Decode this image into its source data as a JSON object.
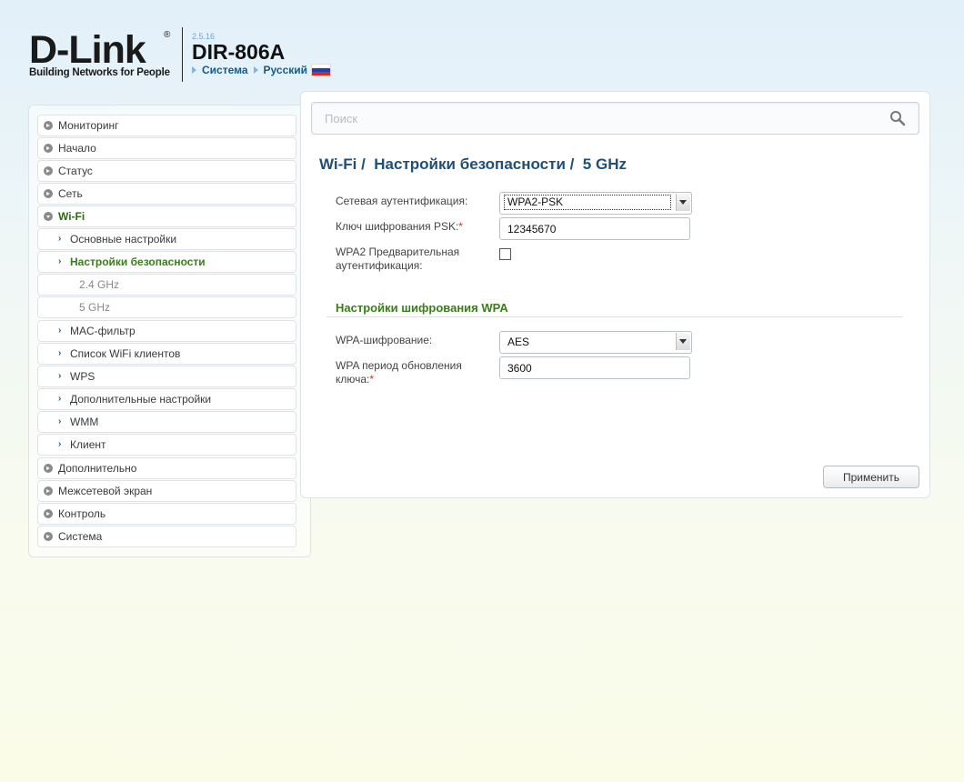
{
  "header": {
    "brand_main": "D-Link",
    "brand_reg": "®",
    "brand_tagline": "Building Networks for People",
    "firmware": "2.5.16",
    "model": "DIR-806A",
    "link_system": "Система",
    "link_language": "Русский",
    "flag_colors": [
      "#ffffff",
      "#1c3fbf",
      "#d52b1e"
    ]
  },
  "sidebar": {
    "items": [
      {
        "label": "Мониторинг"
      },
      {
        "label": "Начало"
      },
      {
        "label": "Статус"
      },
      {
        "label": "Сеть"
      },
      {
        "label": "Wi-Fi"
      },
      {
        "label": "Основные настройки"
      },
      {
        "label": "Настройки безопасности"
      },
      {
        "label": "2.4 GHz"
      },
      {
        "label": "5 GHz"
      },
      {
        "label": "MAC-фильтр"
      },
      {
        "label": "Список WiFi клиентов"
      },
      {
        "label": "WPS"
      },
      {
        "label": "Дополнительные настройки"
      },
      {
        "label": "WMM"
      },
      {
        "label": "Клиент"
      },
      {
        "label": "Дополнительно"
      },
      {
        "label": "Межсетевой экран"
      },
      {
        "label": "Контроль"
      },
      {
        "label": "Система"
      }
    ]
  },
  "search": {
    "placeholder": "Поиск"
  },
  "breadcrumb": "Wi-Fi /  Настройки безопасности /  5 GHz",
  "form": {
    "auth_label": "Сетевая аутентификация:",
    "auth_value": "WPA2-PSK",
    "psk_label": "Ключ шифрования PSK:",
    "psk_value": "12345670",
    "preauth_label_1": "WPA2 Предварительная",
    "preauth_label_2": "аутентификация:",
    "required_mark": "*"
  },
  "wpa_section": {
    "title": "Настройки шифрования WPA",
    "enc_label": "WPA-шифрование:",
    "enc_value": "AES",
    "period_label_1": "WPA период обновления",
    "period_label_2": "ключа:",
    "period_value": "3600"
  },
  "apply_label": "Применить",
  "colors": {
    "accent_green": "#3a7d1a",
    "accent_blue": "#1f4f78"
  }
}
